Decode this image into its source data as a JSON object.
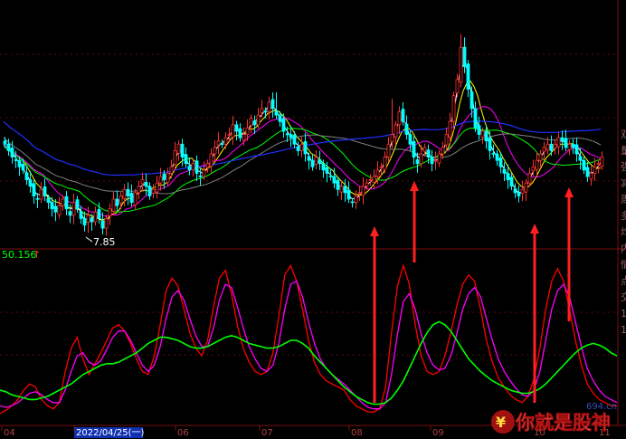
{
  "chart_data": [
    {
      "type": "candlestick",
      "low_marker": {
        "label": "7.85",
        "x": 95,
        "y": 7.85
      },
      "moving_average_colors": [
        "#ffffff",
        "#ffff00",
        "#ff00ff",
        "#00ff00",
        "#808080",
        "#2030ff"
      ],
      "up_color": "#ff3030",
      "down_color": "#00ffff",
      "ohlc_x": [
        0,
        4,
        8,
        12,
        16,
        20,
        24,
        28,
        32,
        36,
        40,
        44,
        48,
        52,
        56,
        60,
        64,
        68,
        72,
        76,
        80,
        84,
        88,
        92,
        96,
        100,
        104,
        108,
        112,
        116,
        120,
        124,
        128,
        132,
        136,
        140,
        144,
        148,
        152,
        156,
        160,
        164,
        168,
        172,
        176,
        180,
        184,
        188,
        192,
        196,
        200,
        204,
        208,
        212,
        216,
        220,
        224,
        228,
        232,
        236,
        240,
        244,
        248,
        252,
        256,
        260,
        264,
        268,
        272,
        276,
        280,
        284,
        288,
        292,
        296,
        300,
        304,
        308,
        312,
        316,
        320,
        324,
        328,
        332,
        336,
        340,
        344,
        348,
        352,
        356,
        360,
        364,
        368,
        372,
        376,
        380,
        384,
        388,
        392,
        396,
        400,
        404,
        408,
        412,
        416,
        420,
        424,
        428,
        432,
        436,
        440,
        444,
        448,
        452,
        456,
        460,
        464,
        468,
        472,
        476,
        480,
        484,
        488,
        492,
        496,
        500,
        504,
        508,
        512,
        516,
        520,
        524,
        528,
        532,
        536,
        540,
        544,
        548,
        552,
        556,
        560,
        564,
        568,
        572,
        576,
        580,
        584,
        588,
        592,
        596,
        600,
        604,
        608,
        612,
        616,
        620,
        624,
        628,
        632,
        636,
        640,
        644,
        648,
        652,
        656,
        660,
        664,
        668,
        672,
        676
      ],
      "close": [
        10.6,
        10.4,
        10.2,
        10.1,
        9.9,
        9.8,
        9.5,
        9.3,
        9.0,
        8.9,
        9.2,
        9.0,
        8.8,
        8.6,
        8.5,
        8.7,
        8.9,
        8.6,
        8.4,
        8.8,
        8.6,
        8.3,
        8.1,
        8.4,
        8.2,
        8.5,
        8.3,
        8.0,
        8.3,
        8.6,
        8.9,
        8.7,
        9.0,
        9.2,
        9.0,
        8.8,
        9.1,
        9.3,
        9.5,
        9.3,
        9.0,
        9.2,
        9.4,
        9.6,
        9.5,
        9.7,
        9.9,
        10.4,
        10.6,
        10.2,
        10.0,
        9.8,
        10.0,
        9.7,
        9.6,
        9.8,
        10.0,
        10.3,
        10.5,
        10.7,
        10.6,
        10.8,
        10.9,
        11.2,
        11.0,
        10.8,
        10.9,
        11.1,
        11.4,
        11.2,
        11.5,
        11.7,
        11.6,
        11.9,
        11.7,
        11.5,
        11.3,
        11.0,
        10.9,
        10.8,
        10.6,
        10.4,
        10.6,
        10.3,
        10.1,
        9.9,
        10.2,
        10.0,
        9.8,
        9.7,
        9.6,
        9.4,
        9.2,
        9.3,
        9.1,
        8.9,
        8.8,
        9.0,
        9.1,
        9.3,
        9.4,
        9.5,
        9.6,
        9.8,
        9.9,
        10.2,
        10.6,
        10.9,
        11.2,
        11.6,
        11.3,
        10.9,
        10.6,
        10.2,
        10.0,
        10.3,
        10.5,
        10.2,
        10.0,
        10.1,
        10.3,
        10.5,
        10.9,
        11.3,
        12.1,
        12.6,
        13.6,
        13.0,
        12.3,
        11.7,
        11.1,
        10.9,
        11.0,
        10.7,
        10.4,
        10.3,
        10.1,
        9.9,
        9.7,
        9.5,
        9.3,
        9.1,
        9.0,
        9.2,
        9.4,
        9.7,
        9.9,
        10.1,
        10.3,
        10.5,
        10.6,
        10.4,
        10.6,
        10.8,
        10.7,
        10.5,
        10.6,
        10.5,
        10.3,
        10.1,
        9.8,
        9.6,
        9.7,
        9.9,
        10.0,
        10.2
      ]
    },
    {
      "type": "line",
      "ylabel": "50.156",
      "series": [
        {
          "color": "#ff0000",
          "values": [
            3,
            5,
            8,
            12,
            18,
            22,
            20,
            12,
            8,
            6,
            10,
            30,
            45,
            52,
            38,
            28,
            35,
            42,
            50,
            58,
            60,
            56,
            48,
            38,
            30,
            28,
            40,
            60,
            82,
            90,
            85,
            70,
            55,
            45,
            40,
            50,
            72,
            90,
            95,
            80,
            60,
            45,
            36,
            30,
            28,
            30,
            42,
            65,
            92,
            98,
            88,
            70,
            50,
            36,
            28,
            24,
            22,
            20,
            18,
            12,
            8,
            6,
            4,
            4,
            6,
            20,
            55,
            85,
            98,
            86,
            60,
            40,
            30,
            28,
            30,
            40,
            55,
            72,
            86,
            92,
            88,
            70,
            50,
            36,
            26,
            20,
            15,
            12,
            10,
            14,
            25,
            45,
            70,
            88,
            96,
            88,
            70,
            50,
            34,
            22,
            16,
            12,
            10,
            8,
            8
          ]
        },
        {
          "color": "#ff00ff",
          "values": [
            8,
            7,
            8,
            10,
            13,
            16,
            17,
            15,
            12,
            10,
            10,
            18,
            30,
            40,
            42,
            36,
            34,
            37,
            44,
            52,
            56,
            56,
            50,
            42,
            34,
            30,
            34,
            46,
            64,
            78,
            82,
            76,
            64,
            53,
            46,
            46,
            58,
            76,
            86,
            84,
            72,
            58,
            46,
            38,
            32,
            30,
            34,
            48,
            70,
            86,
            88,
            78,
            62,
            48,
            38,
            32,
            28,
            25,
            22,
            18,
            14,
            10,
            7,
            6,
            6,
            10,
            28,
            54,
            75,
            80,
            70,
            54,
            42,
            34,
            31,
            32,
            40,
            54,
            70,
            80,
            84,
            78,
            64,
            50,
            38,
            30,
            24,
            19,
            15,
            14,
            18,
            30,
            50,
            70,
            82,
            86,
            78,
            62,
            46,
            32,
            24,
            18,
            14,
            12,
            10
          ]
        },
        {
          "color": "#00ff00",
          "values": [
            18,
            17,
            15,
            14,
            13,
            12,
            12,
            13,
            14,
            16,
            18,
            20,
            22,
            25,
            28,
            30,
            32,
            34,
            35,
            35,
            36,
            38,
            40,
            42,
            45,
            48,
            50,
            52,
            52,
            51,
            50,
            48,
            46,
            45,
            45,
            46,
            48,
            50,
            52,
            53,
            52,
            50,
            48,
            47,
            46,
            45,
            45,
            46,
            48,
            50,
            50,
            48,
            45,
            40,
            36,
            32,
            28,
            24,
            20,
            17,
            14,
            12,
            10,
            9,
            9,
            10,
            13,
            18,
            24,
            32,
            40,
            48,
            55,
            60,
            62,
            60,
            56,
            50,
            44,
            38,
            34,
            30,
            27,
            24,
            22,
            20,
            18,
            17,
            16,
            16,
            17,
            19,
            22,
            26,
            30,
            34,
            38,
            42,
            45,
            47,
            48,
            47,
            45,
            42,
            40
          ]
        }
      ]
    }
  ],
  "right_axis_chars": [
    "双",
    "量",
    "强",
    "减",
    "周",
    "多",
    "均",
    "内",
    "情",
    "点",
    "交",
    "1",
    "1"
  ],
  "time_axis": {
    "labels": [
      "04",
      "2022/04/25(一)",
      "06",
      "07",
      "08",
      "09",
      "10",
      "11"
    ],
    "highlight_index": 1
  },
  "signal_arrows_color": "#ff2020",
  "watermark": {
    "small": "694.cn",
    "brand": "你就是股神"
  }
}
